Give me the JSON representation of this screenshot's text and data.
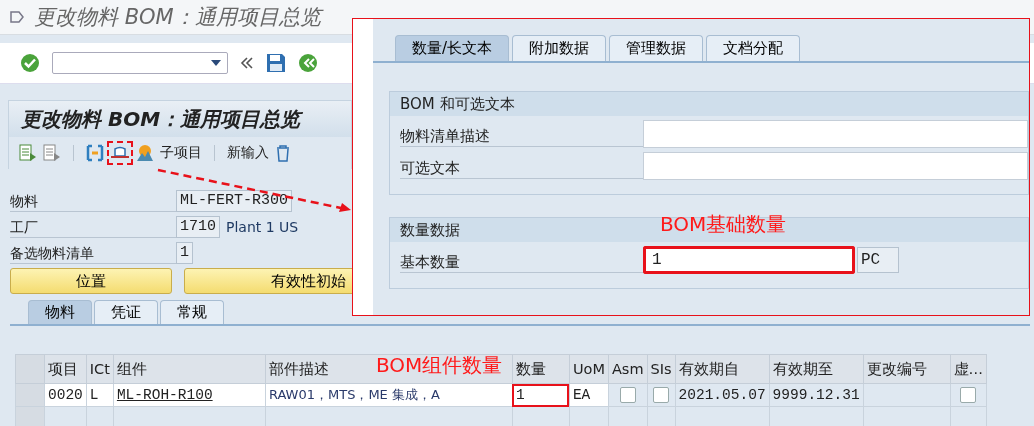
{
  "window": {
    "title": "更改物料 BOM：通用项目总览"
  },
  "screen_title": "更改物料 BOM：通用项目总览",
  "app_toolbar": [
    {
      "label": "子项目"
    },
    {
      "label": "新输入"
    }
  ],
  "header_fields": [
    {
      "label": "物料",
      "value": "ML-FERT-R300"
    },
    {
      "label": "工厂",
      "value": "1710",
      "description": "Plant 1 US"
    },
    {
      "label": "备选物料清单",
      "value": "1"
    }
  ],
  "buttons": [
    "位置",
    "有效性初始"
  ],
  "tabs": [
    {
      "label": "物料",
      "selected": true
    },
    {
      "label": "凭证",
      "selected": false
    },
    {
      "label": "常规",
      "selected": false
    }
  ],
  "table": {
    "columns": [
      "项目",
      "ICt",
      "组件",
      "部件描述",
      "数量",
      "UoM",
      "Asm",
      "SIs",
      "有效期自",
      "有效期至",
      "更改编号",
      "虚…"
    ],
    "rows": [
      {
        "item": "0020",
        "ict": "L",
        "component": "ML-ROH-R100",
        "description": "RAW01，MTS，ME 集成，A",
        "quantity": "1",
        "quantity_highlighted": true,
        "uom": "EA",
        "asm": false,
        "sis": false,
        "valid_from": "2021.05.07",
        "valid_to": "9999.12.31",
        "phantom": false
      }
    ]
  },
  "detail_panel": {
    "tabs": [
      {
        "label": "数量/长文本",
        "selected": true
      },
      {
        "label": "附加数据",
        "selected": false
      },
      {
        "label": "管理数据",
        "selected": false
      },
      {
        "label": "文档分配",
        "selected": false
      }
    ],
    "groups": [
      {
        "title": "BOM 和可选文本",
        "fields": [
          {
            "label": "物料清单描述"
          },
          {
            "label": "可选文本"
          }
        ]
      },
      {
        "title": "数量数据",
        "fields": [
          {
            "label": "基本数量",
            "value": "1",
            "unit": "PC",
            "highlighted": true
          }
        ]
      }
    ]
  },
  "annotations": [
    {
      "text": "BOM基础数量"
    },
    {
      "text": "BOM组件数量"
    }
  ]
}
